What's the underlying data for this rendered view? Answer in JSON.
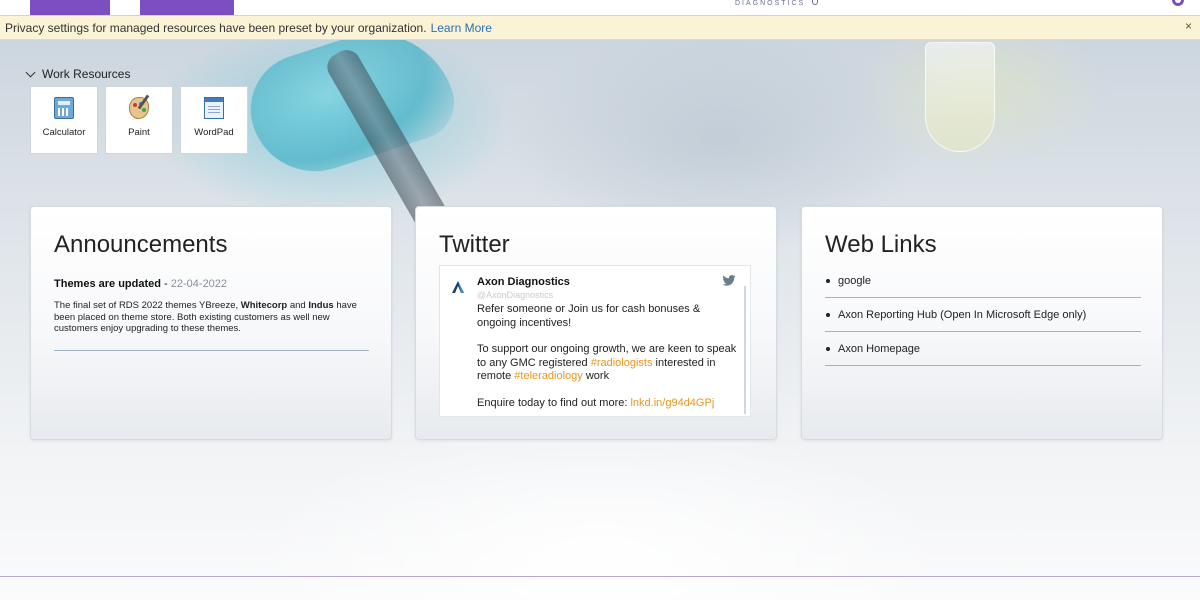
{
  "header": {
    "brand_subtitle": "DIAGNOSTICS"
  },
  "notice": {
    "text": "Privacy settings for managed resources have been preset by your organization.",
    "link": "Learn More",
    "close": "×"
  },
  "work_resources": {
    "title": "Work Resources",
    "items": [
      {
        "label": "Calculator",
        "icon": "calculator-icon"
      },
      {
        "label": "Paint",
        "icon": "paint-palette-icon"
      },
      {
        "label": "WordPad",
        "icon": "wordpad-icon"
      }
    ]
  },
  "announcements": {
    "title": "Announcements",
    "item_title": "Themes are updated",
    "item_separator": " - ",
    "item_date": "22-04-2022",
    "body_1": "The final set of RDS 2022 themes YBreeze, ",
    "body_bold_1": "Whitecorp",
    "body_2": " and ",
    "body_bold_2": "Indus",
    "body_3": " have been placed on theme store. Both existing customers as well new customers enjoy upgrading to these themes."
  },
  "twitter": {
    "title": "Twitter",
    "account_name": "Axon Diagnostics",
    "account_handle": "@AxonDiagnostics",
    "tweet_p1": "Refer someone or Join us for cash bonuses & ongoing incentives!",
    "tweet_p2_a": "To support our ongoing growth, we are keen to speak to any GMC registered ",
    "tweet_p2_tag1": "#radiologists",
    "tweet_p2_b": " interested in remote ",
    "tweet_p2_tag2": "#teleradiology",
    "tweet_p2_c": " work",
    "tweet_p3_a": "Enquire today to find out more: ",
    "tweet_p3_link": "lnkd.in/g94d4GPj",
    "highlight_color": "#e8951c"
  },
  "web_links": {
    "title": "Web Links",
    "items": [
      "google",
      "Axon Reporting Hub (Open In Microsoft Edge only)",
      "Axon Homepage"
    ]
  },
  "colors": {
    "brand_purple": "#7b4fbf",
    "notice_bg": "#fbf3d5",
    "link_blue": "#2d6fb5"
  }
}
